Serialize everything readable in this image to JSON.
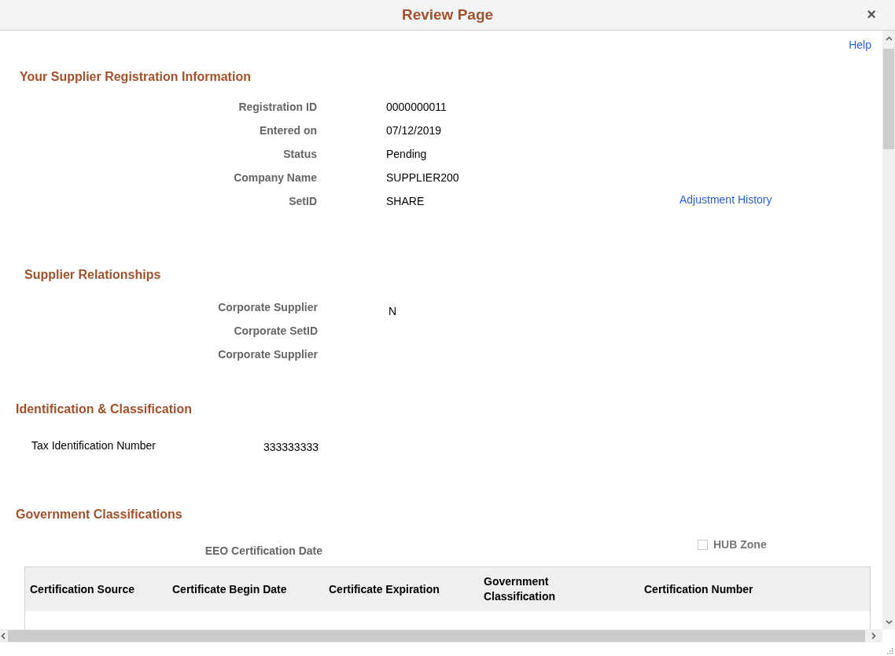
{
  "window": {
    "title": "Review Page",
    "close": "×"
  },
  "help_link": "Help",
  "registration": {
    "heading": "Your Supplier Registration Information",
    "fields": [
      {
        "label": "Registration ID",
        "value": "0000000011"
      },
      {
        "label": "Entered on",
        "value": "07/12/2019"
      },
      {
        "label": "Status",
        "value": "Pending"
      },
      {
        "label": "Company Name",
        "value": "SUPPLIER200"
      },
      {
        "label": "SetID",
        "value": "SHARE"
      }
    ],
    "link": "Adjustment History"
  },
  "relationships": {
    "heading": "Supplier Relationships",
    "fields": [
      {
        "label": "Corporate Supplier",
        "value": "N"
      },
      {
        "label": "Corporate SetID"
      },
      {
        "label": "Corporate Supplier"
      }
    ]
  },
  "identification": {
    "heading": "Identification & Classification",
    "label": "Tax Identification Number",
    "value": "333333333"
  },
  "government": {
    "heading": "Government Classifications",
    "eeo_label": "EEO Certification Date",
    "hub_zone": {
      "label": "HUB Zone",
      "checked": false,
      "disabled": true
    },
    "table": {
      "columns": [
        "Certification Source",
        "Certificate Begin Date",
        "Certificate Expiration",
        "Government Classification",
        "Certification Number"
      ]
    }
  }
}
